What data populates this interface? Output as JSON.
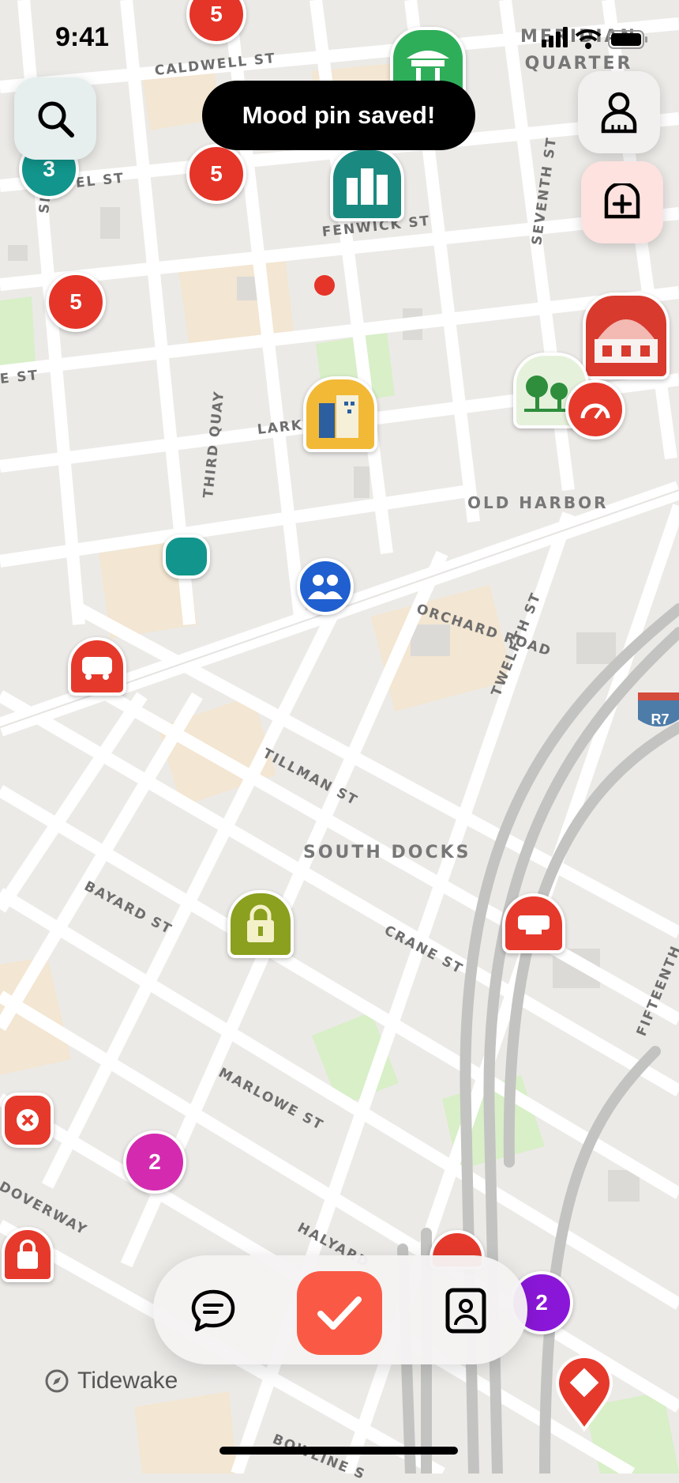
{
  "status_bar": {
    "time": "9:41"
  },
  "toast": {
    "message": "Mood pin saved!"
  },
  "map": {
    "streets": [
      "CALDWELL ST",
      "SEC",
      "EL ST",
      "FENWICK ST",
      "SEVENTH ST",
      "E ST",
      "LARK",
      "THIRD QUAY",
      "ORCHARD ROAD",
      "TWELFTH ST",
      "TILLMAN ST",
      "BAYARD ST",
      "CRANE ST",
      "FIFTEENTH",
      "MARLOWE ST",
      "DOVERWAY",
      "HALYARD",
      "BOWLINE S"
    ],
    "areas": [
      "MERIDIAN QUARTER",
      "OLD HARBOR",
      "SOUTH DOCKS"
    ],
    "route_badge": "R7",
    "clusters": [
      {
        "count": "5",
        "color": "#e53428"
      },
      {
        "count": "3",
        "color": "#12958c"
      },
      {
        "count": "5",
        "color": "#e53428"
      },
      {
        "count": "5",
        "color": "#e53428"
      },
      {
        "count": "2",
        "color": "#d42aaf"
      },
      {
        "count": "2",
        "color": "#8a17d8"
      }
    ]
  },
  "tabbar": {
    "items": [
      "chat",
      "check-in",
      "profile-card"
    ]
  },
  "location": {
    "name": "Tidewake"
  }
}
